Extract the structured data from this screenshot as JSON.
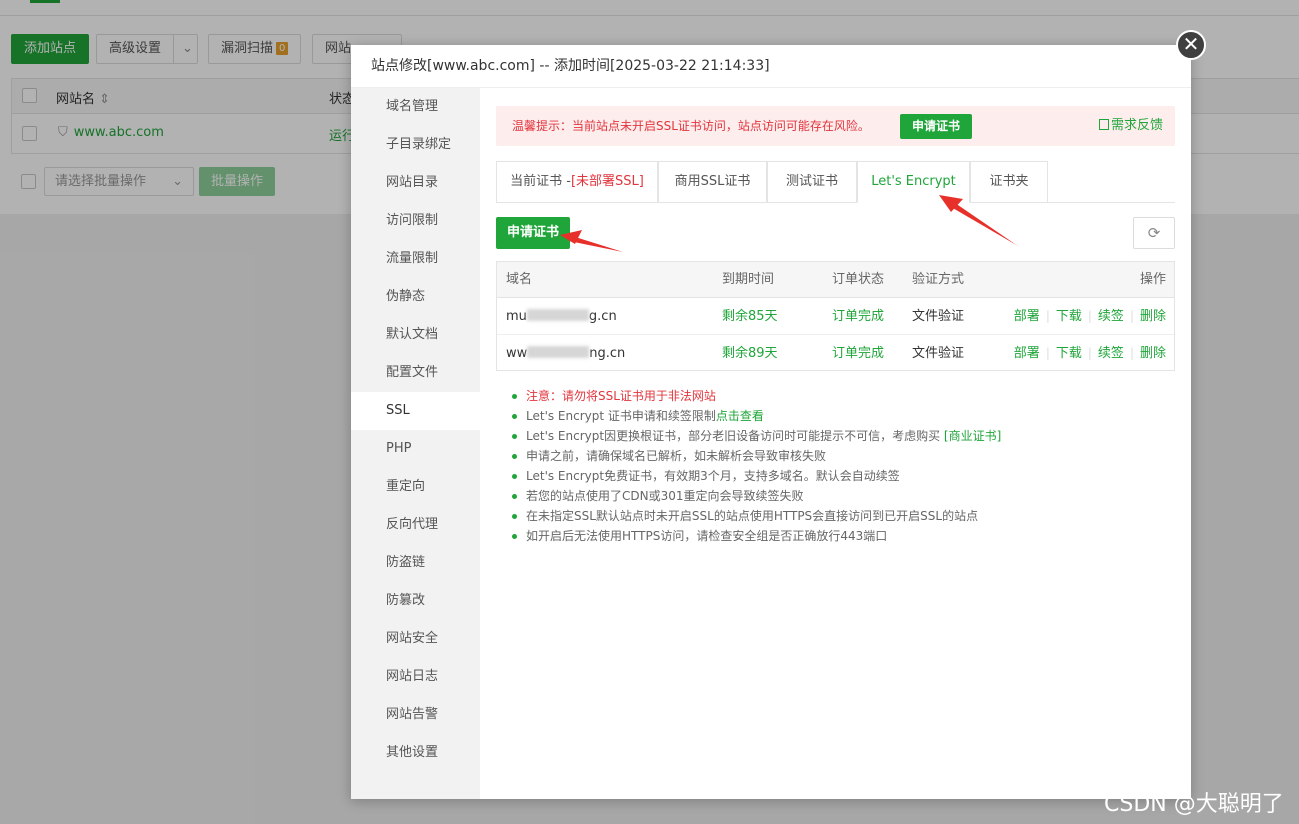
{
  "background": {
    "toolbar": {
      "add_site": "添加站点",
      "advanced": "高级设置",
      "vuln_scan": "漏洞扫描",
      "vuln_badge": "0",
      "website": "网站"
    },
    "table": {
      "col_name": "网站名",
      "col_status": "状态",
      "row_site": "www.abc.com",
      "row_status": "运行"
    },
    "footer": {
      "batch_placeholder": "请选择批量操作",
      "batch_button": "批量操作"
    }
  },
  "modal": {
    "title": "站点修改[www.abc.com] -- 添加时间[2025-03-22 21:14:33]",
    "close_glyph": "✕",
    "sidebar": [
      {
        "label": "域名管理"
      },
      {
        "label": "子目录绑定"
      },
      {
        "label": "网站目录"
      },
      {
        "label": "访问限制"
      },
      {
        "label": "流量限制"
      },
      {
        "label": "伪静态"
      },
      {
        "label": "默认文档"
      },
      {
        "label": "配置文件"
      },
      {
        "label": "SSL"
      },
      {
        "label": "PHP"
      },
      {
        "label": "重定向"
      },
      {
        "label": "反向代理"
      },
      {
        "label": "防盗链"
      },
      {
        "label": "防篡改"
      },
      {
        "label": "网站安全"
      },
      {
        "label": "网站日志"
      },
      {
        "label": "网站告警"
      },
      {
        "label": "其他设置"
      }
    ],
    "active_sidebar_index": 8,
    "warning": {
      "text": "温馨提示：当前站点未开启SSL证书访问，站点访问可能存在风险。",
      "button": "申请证书",
      "feedback": "需求反馈"
    },
    "tabs": [
      {
        "label": "当前证书 -",
        "suffix": "[未部署SSL]"
      },
      {
        "label": "商用SSL证书"
      },
      {
        "label": "测试证书"
      },
      {
        "label": "Let's Encrypt"
      },
      {
        "label": "证书夹"
      }
    ],
    "active_tab_index": 3,
    "apply_button": "申请证书",
    "refresh_glyph": "⟳",
    "cert_table": {
      "headers": [
        "域名",
        "到期时间",
        "订单状态",
        "验证方式",
        "操作"
      ],
      "rows": [
        {
          "domain_prefix": "mu",
          "domain_suffix": "g.cn",
          "expires": "剩余85天",
          "status": "订单完成",
          "verify": "文件验证"
        },
        {
          "domain_prefix": "ww",
          "domain_suffix": "ng.cn",
          "expires": "剩余89天",
          "status": "订单完成",
          "verify": "文件验证"
        }
      ],
      "ops": [
        "部署",
        "下载",
        "续签",
        "删除"
      ]
    },
    "notes": {
      "n1": "注意：请勿将SSL证书用于非法网站",
      "n2_text": "Let's Encrypt 证书申请和续签限制",
      "n2_link": "点击查看",
      "n3_text": "Let's Encrypt因更换根证书，部分老旧设备访问时可能提示不可信，考虑购买",
      "n3_link": "[商业证书]",
      "n4": "申请之前，请确保域名已解析，如未解析会导致审核失败",
      "n5": "Let's Encrypt免费证书，有效期3个月，支持多域名。默认会自动续签",
      "n6": "若您的站点使用了CDN或301重定向会导致续签失败",
      "n7": "在未指定SSL默认站点时未开启SSL的站点使用HTTPS会直接访问到已开启SSL的站点",
      "n8": "如开启后无法使用HTTPS访问，请检查安全组是否正确放行443端口"
    }
  },
  "watermark": "CSDN @大聪明了",
  "colors": {
    "brand_green": "#20a53a",
    "warning_red": "#e2353d",
    "warning_bg": "#fdeded",
    "arrow_red": "#e8302a"
  }
}
